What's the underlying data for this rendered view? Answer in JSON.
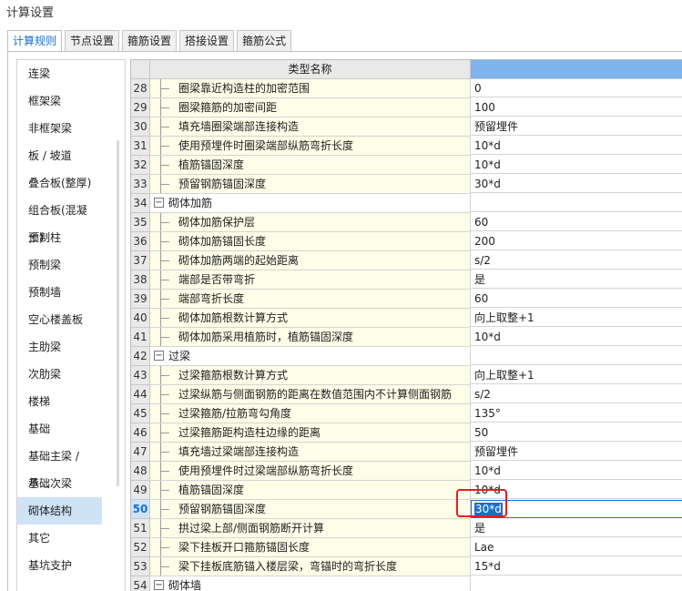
{
  "window": {
    "title": "计算设置"
  },
  "tabs": [
    "计算规则",
    "节点设置",
    "箍筋设置",
    "搭接设置",
    "箍筋公式"
  ],
  "sidebar": {
    "items": [
      "连梁",
      "框架梁",
      "非框架梁",
      "板 / 坡道",
      "叠合板(整厚)",
      "组合板(混凝土)",
      "预制柱",
      "预制梁",
      "预制墙",
      "空心楼盖板",
      "主肋梁",
      "次肋梁",
      "楼梯",
      "基础",
      "基础主梁 / 承...",
      "基础次梁",
      "砌体结构",
      "其它",
      "基坑支护"
    ],
    "selected_index": 16
  },
  "grid": {
    "header": {
      "name_col": "类型名称",
      "value_col": ""
    },
    "rows": [
      {
        "n": "28",
        "name": "圈梁靠近构造柱的加密范围",
        "value": "0",
        "type": "child"
      },
      {
        "n": "29",
        "name": "圈梁箍筋的加密间距",
        "value": "100",
        "type": "child"
      },
      {
        "n": "30",
        "name": "填充墙圈梁端部连接构造",
        "value": "预留埋件",
        "type": "child"
      },
      {
        "n": "31",
        "name": "使用预埋件时圈梁端部纵筋弯折长度",
        "value": "10*d",
        "type": "child"
      },
      {
        "n": "32",
        "name": "植筋锚固深度",
        "value": "10*d",
        "type": "child"
      },
      {
        "n": "33",
        "name": "预留钢筋锚固深度",
        "value": "30*d",
        "type": "child"
      },
      {
        "n": "34",
        "name": "砌体加筋",
        "value": "",
        "type": "group",
        "toggle": "−"
      },
      {
        "n": "35",
        "name": "砌体加筋保护层",
        "value": "60",
        "type": "child"
      },
      {
        "n": "36",
        "name": "砌体加筋锚固长度",
        "value": "200",
        "type": "child"
      },
      {
        "n": "37",
        "name": "砌体加筋两端的起始距离",
        "value": "s/2",
        "type": "child"
      },
      {
        "n": "38",
        "name": "端部是否带弯折",
        "value": "是",
        "type": "child"
      },
      {
        "n": "39",
        "name": "端部弯折长度",
        "value": "60",
        "type": "child"
      },
      {
        "n": "40",
        "name": "砌体加筋根数计算方式",
        "value": "向上取整+1",
        "type": "child"
      },
      {
        "n": "41",
        "name": "砌体加筋采用植筋时，植筋锚固深度",
        "value": "10*d",
        "type": "child"
      },
      {
        "n": "42",
        "name": "过梁",
        "value": "",
        "type": "group",
        "toggle": "−"
      },
      {
        "n": "43",
        "name": "过梁箍筋根数计算方式",
        "value": "向上取整+1",
        "type": "child"
      },
      {
        "n": "44",
        "name": "过梁纵筋与侧面钢筋的距离在数值范围内不计算侧面钢筋",
        "value": "s/2",
        "type": "child"
      },
      {
        "n": "45",
        "name": "过梁箍筋/拉筋弯勾角度",
        "value": "135°",
        "type": "child"
      },
      {
        "n": "46",
        "name": "过梁箍筋距构造柱边缘的距离",
        "value": "50",
        "type": "child"
      },
      {
        "n": "47",
        "name": "填充墙过梁端部连接构造",
        "value": "预留埋件",
        "type": "child"
      },
      {
        "n": "48",
        "name": "使用预埋件时过梁端部纵筋弯折长度",
        "value": "10*d",
        "type": "child"
      },
      {
        "n": "49",
        "name": "植筋锚固深度",
        "value": "10*d",
        "type": "child"
      },
      {
        "n": "50",
        "name": "预留钢筋锚固深度",
        "value": "30*d",
        "type": "editing"
      },
      {
        "n": "51",
        "name": "拱过梁上部/侧面钢筋断开计算",
        "value": "是",
        "type": "child"
      },
      {
        "n": "52",
        "name": "梁下挂板开口箍筋锚固长度",
        "value": "Lae",
        "type": "child"
      },
      {
        "n": "53",
        "name": "梁下挂板底筋锚入楼层梁，弯锚时的弯折长度",
        "value": "15*d",
        "type": "child"
      },
      {
        "n": "54",
        "name": "砌体墙",
        "value": "",
        "type": "group",
        "toggle": "−"
      }
    ]
  },
  "colors": {
    "accent": "#1a6fc9",
    "header_value_col": "#7fb4ec",
    "name_col_bg": "#fdfde8",
    "highlight_mark": "#e02020"
  }
}
